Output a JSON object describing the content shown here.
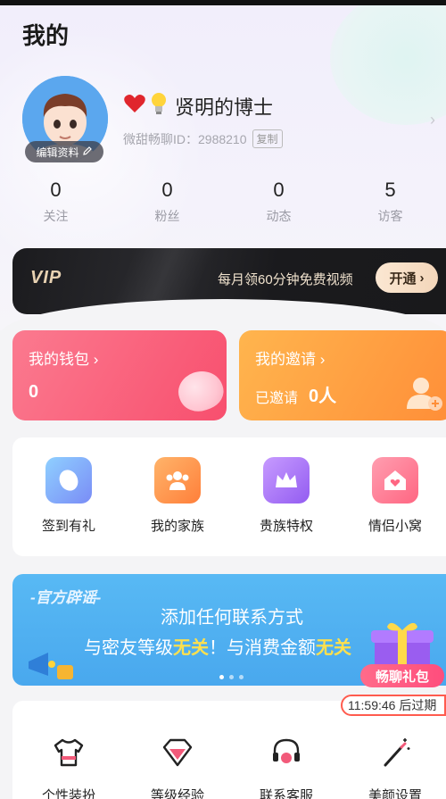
{
  "page": {
    "title": "我的"
  },
  "profile": {
    "nickname": "贤明的博士",
    "id_label": "微甜畅聊ID：",
    "id_value": "2988210",
    "copy_label": "复制",
    "edit_label": "编辑资料"
  },
  "stats": [
    {
      "value": "0",
      "label": "关注"
    },
    {
      "value": "0",
      "label": "粉丝"
    },
    {
      "value": "0",
      "label": "动态"
    },
    {
      "value": "5",
      "label": "访客"
    }
  ],
  "vip": {
    "logo": "VIP",
    "text": "每月领60分钟免费视频",
    "button": "开通"
  },
  "wallet": {
    "title": "我的钱包",
    "value": "0"
  },
  "invite": {
    "title": "我的邀请",
    "label": "已邀请",
    "value": "0人"
  },
  "features": [
    {
      "label": "签到有礼",
      "color": "#7fb1f6",
      "icon": "bean-icon"
    },
    {
      "label": "我的家族",
      "color": "#ff9d4d",
      "icon": "family-icon"
    },
    {
      "label": "贵族特权",
      "color": "#a778f5",
      "icon": "crown-icon"
    },
    {
      "label": "情侣小窝",
      "color": "#ff7b8f",
      "icon": "home-heart-icon"
    }
  ],
  "banner": {
    "tag": "-官方辟谣-",
    "line1": "添加任何联系方式",
    "line2_a": "与密友等级",
    "line2_b": "无关",
    "line2_c": "！与消费金额",
    "line2_d": "无关"
  },
  "gift": {
    "label": "畅聊礼包",
    "timer": "11:59:46 后过期"
  },
  "tools": [
    {
      "label": "个性装扮",
      "icon": "tshirt-icon"
    },
    {
      "label": "等级经验",
      "icon": "diamond-icon"
    },
    {
      "label": "联系客服",
      "icon": "headset-icon"
    },
    {
      "label": "美颜设置",
      "icon": "magic-wand-icon"
    }
  ]
}
